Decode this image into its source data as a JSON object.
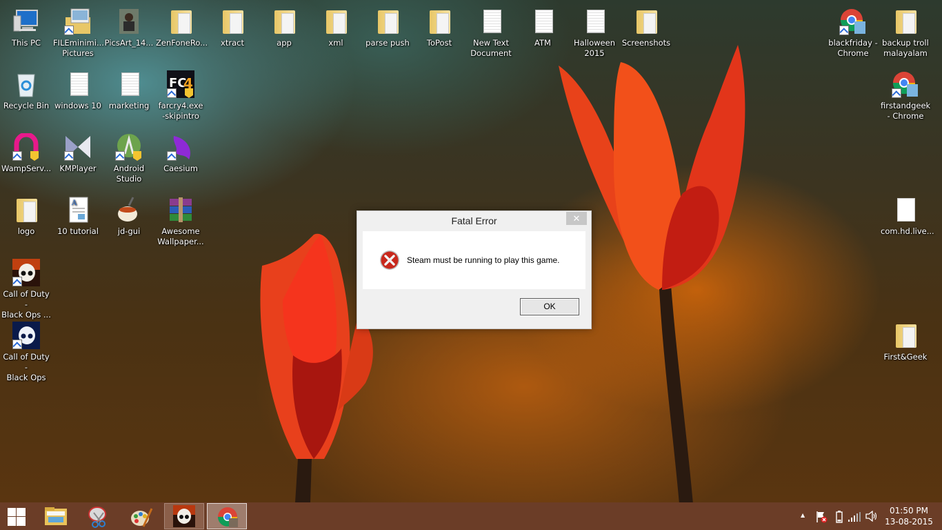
{
  "desktop": {
    "icons": [
      {
        "label": "This PC",
        "type": "pc"
      },
      {
        "label": "FILEminimi...\nPictures",
        "type": "pictures"
      },
      {
        "label": "PicsArt_14...",
        "type": "photo"
      },
      {
        "label": "ZenFoneRo...",
        "type": "folder"
      },
      {
        "label": "xtract",
        "type": "folder"
      },
      {
        "label": "app",
        "type": "folder"
      },
      {
        "label": "xml",
        "type": "folder"
      },
      {
        "label": "parse push",
        "type": "folder"
      },
      {
        "label": "ToPost",
        "type": "folder"
      },
      {
        "label": "New Text\nDocument",
        "type": "text"
      },
      {
        "label": "ATM",
        "type": "text"
      },
      {
        "label": "Halloween\n2015",
        "type": "text"
      },
      {
        "label": "Screenshots",
        "type": "folder"
      },
      {
        "label": "blackfriday -\nChrome",
        "type": "chrome"
      },
      {
        "label": "backup troll\nmalayalam",
        "type": "folder"
      },
      {
        "label": "Recycle Bin",
        "type": "recycle"
      },
      {
        "label": "windows 10",
        "type": "text"
      },
      {
        "label": "marketing",
        "type": "text"
      },
      {
        "label": "farcry4.exe\n-skipintro",
        "type": "farcry"
      },
      {
        "label": "firstandgeek\n- Chrome",
        "type": "chrome"
      },
      {
        "label": "WampServ...",
        "type": "wamp"
      },
      {
        "label": "KMPlayer",
        "type": "kmplayer"
      },
      {
        "label": "Android\nStudio",
        "type": "android"
      },
      {
        "label": "Caesium",
        "type": "caesium"
      },
      {
        "label": "logo",
        "type": "folder"
      },
      {
        "label": "10 tutorial",
        "type": "doc"
      },
      {
        "label": "jd-gui",
        "type": "java"
      },
      {
        "label": "Awesome\nWallpaper...",
        "type": "rar"
      },
      {
        "label": "com.hd.live...",
        "type": "generic"
      },
      {
        "label": "Call of Duty -\nBlack Ops ...",
        "type": "cod-red"
      },
      {
        "label": "Call of Duty -\nBlack Ops",
        "type": "cod-blue"
      },
      {
        "label": "First&Geek",
        "type": "folder"
      }
    ]
  },
  "dialog": {
    "title": "Fatal Error",
    "close_glyph": "✕",
    "message": "Steam must be running to play this game.",
    "ok_label": "OK",
    "icon": "error-icon"
  },
  "taskbar": {
    "start_icon": "windows-logo-icon",
    "pinned": [
      {
        "name": "file-explorer",
        "active": false
      },
      {
        "name": "snipping-tool",
        "active": false
      },
      {
        "name": "paint",
        "active": false
      },
      {
        "name": "call-of-duty-black-ops",
        "active": true
      },
      {
        "name": "google-chrome",
        "active": true
      }
    ],
    "tray": {
      "show_hidden_glyph": "▲",
      "icons": [
        "action-center-flag-icon",
        "battery-icon",
        "signal-icon",
        "volume-icon"
      ]
    },
    "clock": {
      "time": "01:50 PM",
      "date": "13-08-2015"
    }
  },
  "colors": {
    "taskbar": "#6b3d27",
    "dialog_bg": "#f0f0f0",
    "error_red": "#c8281c"
  }
}
